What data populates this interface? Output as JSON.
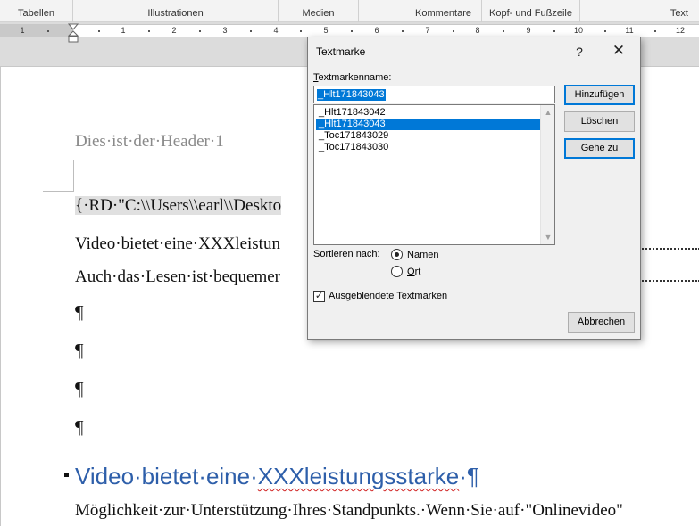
{
  "ribbon": {
    "groups": [
      "Tabellen",
      "Illustrationen",
      "Medien",
      "Kommentare",
      "Kopf- und Fußzeile",
      "Text"
    ]
  },
  "ruler": {
    "ticks": [
      "1",
      "1",
      "2",
      "3",
      "4",
      "5",
      "6",
      "7",
      "8",
      "9",
      "10",
      "11",
      "12"
    ]
  },
  "document": {
    "header": "Dies·ist·der·Header·1",
    "field_line": "{·RD·\"C:\\\\Users\\\\earl\\\\Deskto",
    "line2": "Video·bietet·eine·XXXleistun",
    "line3": "Auch·das·Lesen·ist·bequemer",
    "pilcrow": "¶",
    "heading_a": "Video·bietet·eine·",
    "heading_b": "XXXleistungsstarke",
    "heading_c": "·¶",
    "last_line": "Möglichkeit·zur·Unterstützung·Ihres·Standpunkts.·Wenn·Sie·auf·\"Onlinevideo\""
  },
  "dialog": {
    "title": "Textmarke",
    "help": "?",
    "close": "✕",
    "name_label_first": "T",
    "name_label_rest": "extmarkenname:",
    "name_value": "_Hlt171843043",
    "list": [
      "_Hlt171843042",
      "_Hlt171843043",
      "_Toc171843029",
      "_Toc171843030"
    ],
    "selected_index": 1,
    "buttons": {
      "add": "Hinzufügen",
      "delete": "Löschen",
      "goto": "Gehe zu",
      "cancel": "Abbrechen"
    },
    "sort_label": "Sortieren nach:",
    "sort_name_first": "N",
    "sort_name_rest": "amen",
    "sort_place_first": "O",
    "sort_place_rest": "rt",
    "hidden_first": "A",
    "hidden_rest": "usgeblendete Textmarken",
    "hidden_checked": true
  }
}
